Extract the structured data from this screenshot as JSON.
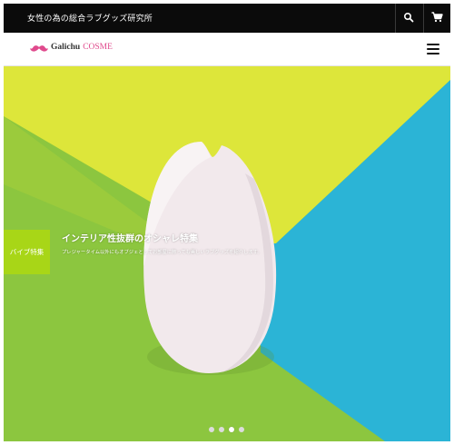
{
  "topbar": {
    "tagline": "女性の為の総合ラブグッズ研究所",
    "search_icon": "search-icon",
    "cart_icon": "cart-icon"
  },
  "header": {
    "logo_text_1": "Galichu",
    "logo_text_2": "COSME",
    "menu_icon": "hamburger-menu-icon",
    "brand_color": "#e04a8d"
  },
  "hero": {
    "badge": "バイブ特集",
    "headline": "インテリア性抜群のオシャレ特集",
    "subline": "プレジャータイム以外にもオブジェとしてお部屋に飾っても美しいラブグッズを紹介します。",
    "slides_total": 4,
    "active_slide": 3,
    "colors": {
      "yellow": "#dde63a",
      "green": "#8cc63f",
      "blue": "#2bb4d6",
      "badge": "#a8d617"
    }
  }
}
